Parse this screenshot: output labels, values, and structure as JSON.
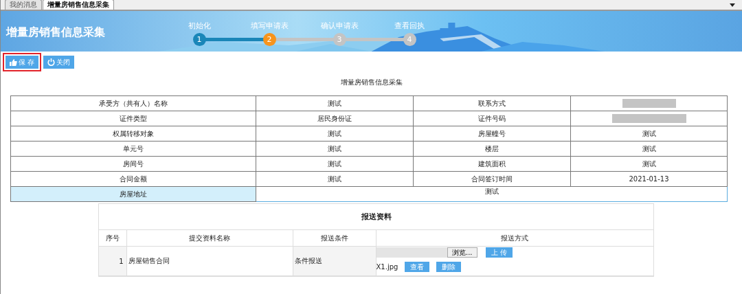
{
  "tabs": [
    {
      "label": "我的消息",
      "selected": false
    },
    {
      "label": "增量房销售信息采集",
      "selected": true
    }
  ],
  "header": {
    "title": "增量房销售信息采集",
    "steps": [
      {
        "label": "初始化",
        "number": "1",
        "completed": true,
        "current": false
      },
      {
        "label": "填写申请表",
        "number": "2",
        "completed": false,
        "current": true
      },
      {
        "label": "确认申请表",
        "number": "3",
        "completed": false,
        "current": false
      },
      {
        "label": "查看回执",
        "number": "4",
        "completed": false,
        "current": false
      }
    ]
  },
  "toolbar": [
    {
      "label": "保 存",
      "kind": "save",
      "highlighted": true
    },
    {
      "label": "关闭",
      "kind": "close",
      "highlighted": false
    }
  ],
  "form": {
    "title": "增量房销售信息采集",
    "rows": [
      [
        {
          "label": "承受方（共有人）名称",
          "value": "测试"
        },
        {
          "label": "联系方式",
          "redacted": true
        }
      ],
      [
        {
          "label": "证件类型",
          "value": "居民身份证"
        },
        {
          "label": "证件号码",
          "redacted": true
        }
      ],
      [
        {
          "label": "权属转移对象",
          "value": "测试"
        },
        {
          "label": "房屋幢号",
          "value": "测试"
        }
      ],
      [
        {
          "label": "单元号",
          "value": "测试"
        },
        {
          "label": "楼层",
          "value": "测试"
        }
      ],
      [
        {
          "label": "房间号",
          "value": "测试"
        },
        {
          "label": "建筑面积",
          "value": "测试"
        }
      ],
      [
        {
          "label": "合同金额",
          "value": "测试"
        },
        {
          "label": "合同签订时间",
          "value": "2021-01-13"
        }
      ]
    ],
    "address": {
      "label": "房屋地址",
      "value": "测试"
    }
  },
  "materials": {
    "title": "报送资料",
    "columns": [
      "序号",
      "提交资料名称",
      "报送条件",
      "报送方式"
    ],
    "rows": [
      {
        "index": "1",
        "name": "房屋销售合同",
        "condition": "条件报送",
        "browse": "浏览...",
        "upload": "上 传",
        "file": "X1.jpg",
        "view": "查看",
        "delete": "删除"
      }
    ]
  }
}
